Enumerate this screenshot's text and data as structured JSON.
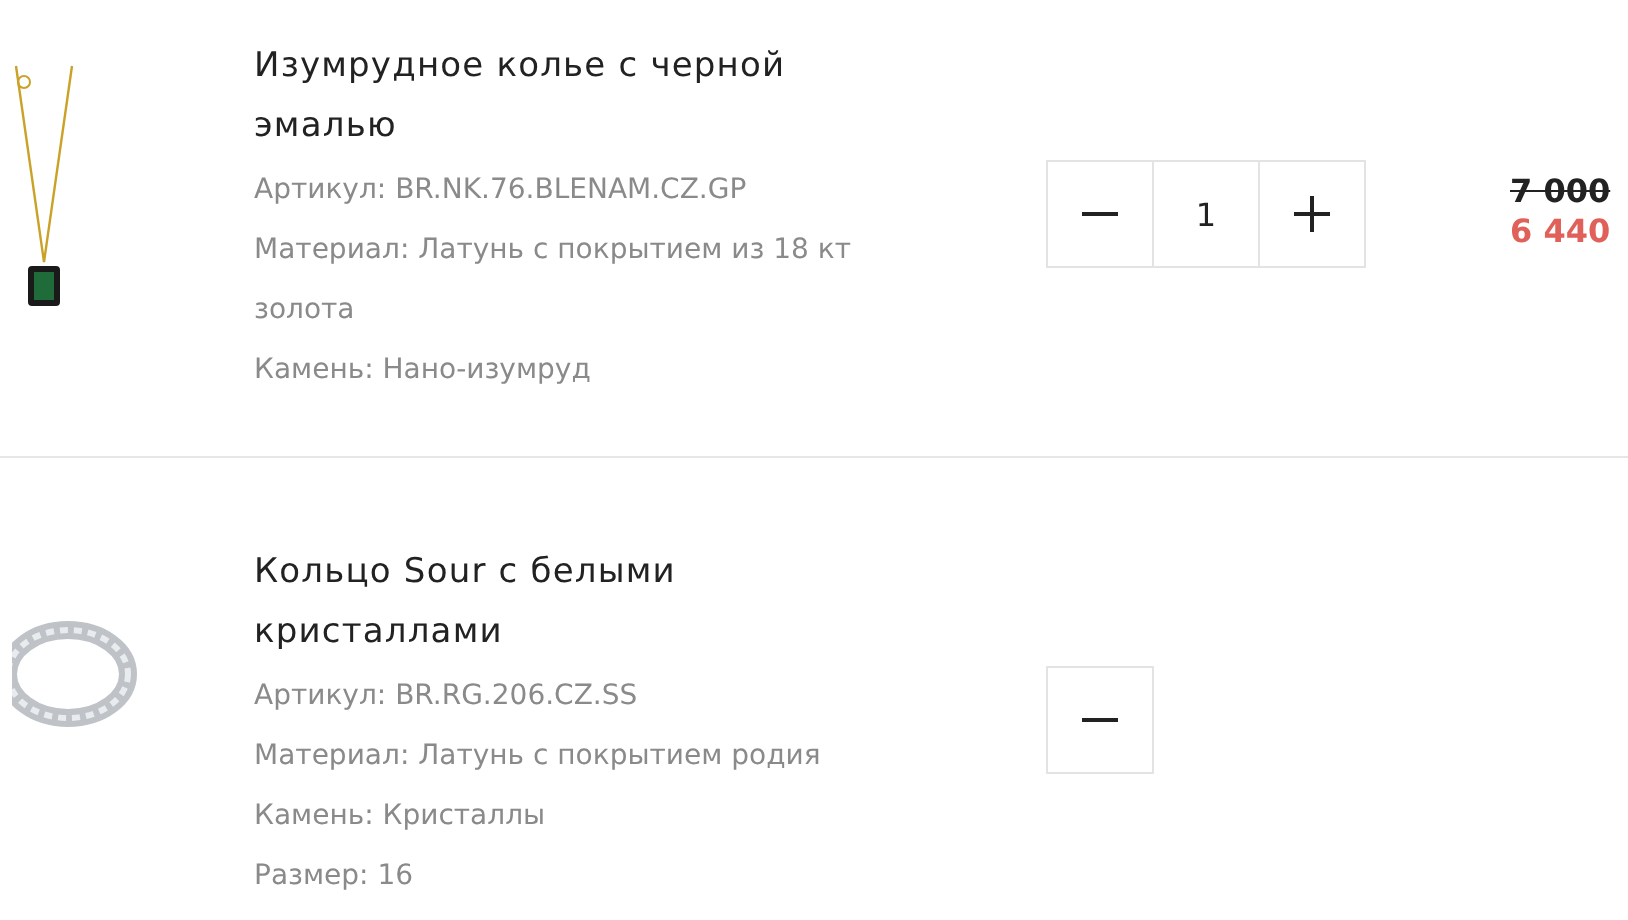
{
  "items": [
    {
      "kind": "necklace",
      "title": "Изумрудное колье с черной эмалью",
      "details": [
        "Артикул: BR.NK.76.BLENAM.CZ.GP",
        "Материал: Латунь с покрытием из 18 кт золота",
        "Камень: Нано-изумруд"
      ],
      "quantity": "1",
      "old_price": "7 000",
      "price": "6 440"
    },
    {
      "kind": "ring",
      "title": "Кольцо Sour с белыми кристаллами",
      "details": [
        "Артикул: BR.RG.206.CZ.SS",
        "Материал: Латунь с покрытием родия",
        "Камень: Кристаллы",
        "Размер: 16"
      ]
    }
  ]
}
